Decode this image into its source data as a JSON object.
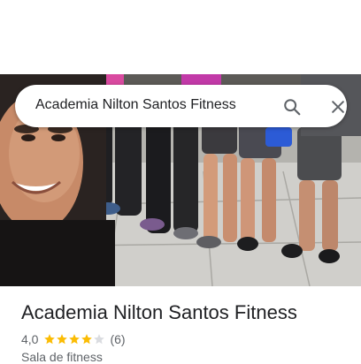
{
  "search": {
    "query": "Academia Nilton Santos Fitness",
    "search_icon": "search-icon",
    "close_icon": "close-icon"
  },
  "place": {
    "name": "Academia Nilton Santos Fitness",
    "rating": "4,0",
    "rating_stars": 4,
    "rating_max": 5,
    "review_count": "(6)",
    "category": "Sala de fitness"
  },
  "colors": {
    "star_filled": "#fbbc04",
    "star_empty": "#dadce0",
    "text_primary": "#202124",
    "text_secondary": "#5f6368"
  }
}
